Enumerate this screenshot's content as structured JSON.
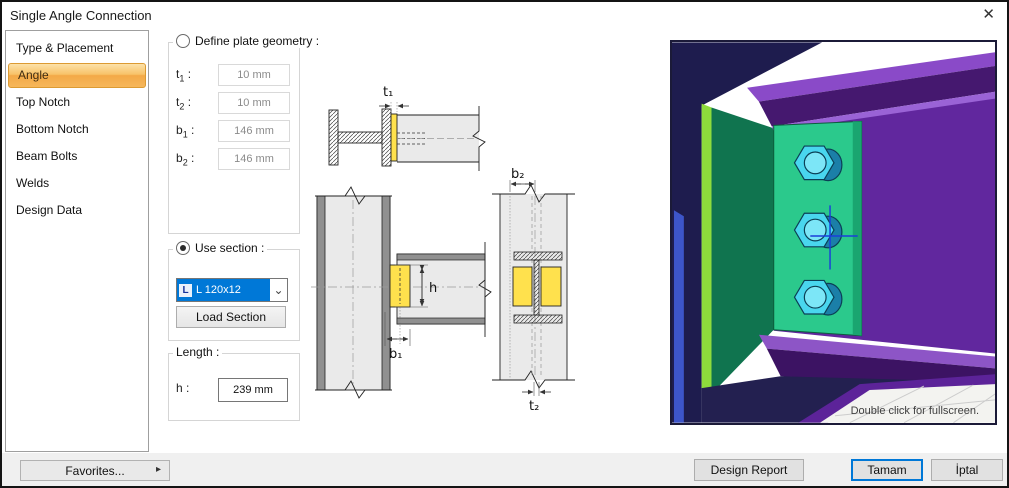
{
  "window": {
    "title": "Single Angle Connection",
    "close_icon": "✕"
  },
  "sidebar": {
    "items": [
      {
        "label": "Type & Placement",
        "selected": false
      },
      {
        "label": "Angle",
        "selected": true
      },
      {
        "label": "Top Notch",
        "selected": false
      },
      {
        "label": "Bottom Notch",
        "selected": false
      },
      {
        "label": "Beam Bolts",
        "selected": false
      },
      {
        "label": "Welds",
        "selected": false
      },
      {
        "label": "Design Data",
        "selected": false
      }
    ]
  },
  "plate_geometry": {
    "radio_label": "Define plate geometry :",
    "selected": false,
    "fields": [
      {
        "name": "t",
        "sub": "1",
        "suffix": " :",
        "value": "10 mm"
      },
      {
        "name": "t",
        "sub": "2",
        "suffix": " :",
        "value": "10 mm"
      },
      {
        "name": "b",
        "sub": "1",
        "suffix": " :",
        "value": "146 mm"
      },
      {
        "name": "b",
        "sub": "2",
        "suffix": " :",
        "value": "146 mm"
      }
    ]
  },
  "use_section": {
    "radio_label": "Use section :",
    "selected": true,
    "dropdown_value": "L 120x12",
    "dropdown_icon": "L",
    "dropdown_arrow": "⌄",
    "load_button": "Load Section"
  },
  "length_group": {
    "label": "Length :",
    "field_label": "h :",
    "value": "239 mm"
  },
  "drawing_labels": {
    "t1": "t₁",
    "t2": "t₂",
    "b1": "b₁",
    "b2": "b₂",
    "h": "h"
  },
  "viewport": {
    "status": "Double click for fullscreen."
  },
  "footer": {
    "favorites": "Favorites...",
    "favorites_arrow": "▸",
    "design_report": "Design Report",
    "ok": "Tamam",
    "cancel": "İptal"
  },
  "colors": {
    "accent_blue": "#0078D7",
    "sidebar_highlight": "#F3A947",
    "plate_yellow": "#FFE14D",
    "model_green": "#2BC98C",
    "model_purple": "#61279E",
    "model_navy": "#1E1C4E",
    "bolt_cyan": "#49D6EE"
  }
}
